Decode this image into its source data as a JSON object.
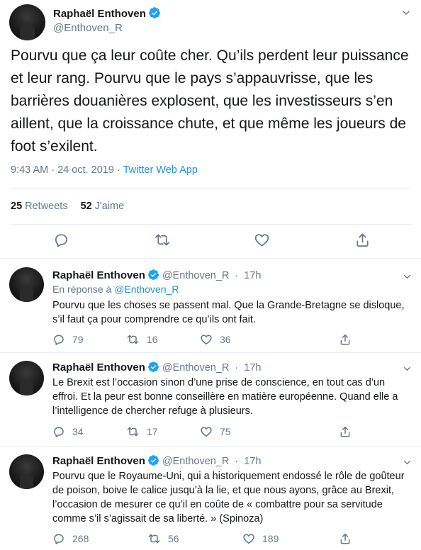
{
  "main_tweet": {
    "author_name": "Raphaël Enthoven",
    "author_handle": "@Enthoven_R",
    "text": "Pourvu que ça leur coûte cher. Qu’ils perdent leur puissance et leur rang. Pourvu que le pays s’appauvrisse, que les barrières douanières explosent, que les investisseurs s’en aillent, que la croissance chute, et que même les joueurs de foot s’exilent.",
    "time": "9:43 AM",
    "date": "24 oct. 2019",
    "separator": "·",
    "source_app": "Twitter Web App",
    "retweets_count": "25",
    "retweets_label": "Retweets",
    "likes_count": "52",
    "likes_label": "J'aime"
  },
  "replies": [
    {
      "author_name": "Raphaël Enthoven",
      "author_handle": "@Enthoven_R",
      "time_sep": "·",
      "time": "17h",
      "in_reply_prefix": "En réponse à",
      "in_reply_handle": "@Enthoven_R",
      "text": "Pourvu que les choses se passent mal. Que la Grande-Bretagne se disloque, s’il faut ça pour comprendre ce qu’ils ont fait.",
      "reply_count": "79",
      "retweet_count": "16",
      "like_count": "36"
    },
    {
      "author_name": "Raphaël Enthoven",
      "author_handle": "@Enthoven_R",
      "time_sep": "·",
      "time": "17h",
      "text": "Le Brexit est l’occasion sinon d’une prise de conscience, en tout cas d’un effroi. Et la peur est bonne conseillère en matière européenne. Quand elle a l’intelligence de chercher refuge à plusieurs.",
      "reply_count": "34",
      "retweet_count": "17",
      "like_count": "75"
    },
    {
      "author_name": "Raphaël Enthoven",
      "author_handle": "@Enthoven_R",
      "time_sep": "·",
      "time": "17h",
      "text": "Pourvu que le Royaume-Uni, qui a historiquement endossé le rôle de goûteur de poison, boive le calice jusqu’à la lie, et que nous ayons, grâce au Brexit, l’occasion de mesurer ce qu’il en coûte de « combattre pour sa servitude comme s’il s’agissait de sa liberté. » (Spinoza)",
      "reply_count": "268",
      "retweet_count": "56",
      "like_count": "189"
    }
  ],
  "icons": {
    "verified": "verified-badge-icon",
    "chevron": "chevron-down-icon",
    "reply": "reply-icon",
    "retweet": "retweet-icon",
    "like": "heart-icon",
    "share": "share-icon"
  },
  "colors": {
    "accent": "#1da1f2",
    "link": "#1b95e0",
    "secondary_text": "#657786",
    "divider": "#e6ecf0"
  }
}
